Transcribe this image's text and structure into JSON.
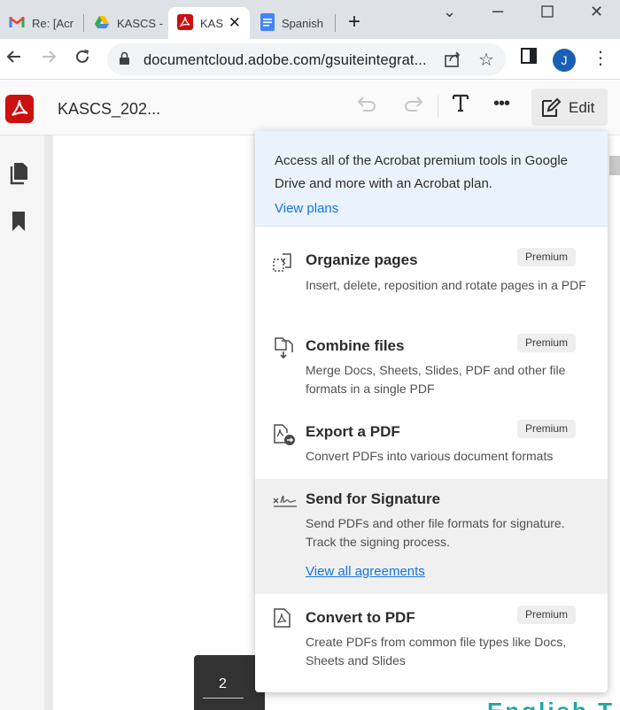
{
  "browser": {
    "tabs": [
      {
        "label": "Re: [Acr",
        "icon": "gmail-icon"
      },
      {
        "label": "KASCS -",
        "icon": "google-drive-icon"
      },
      {
        "label": "KAS",
        "icon": "adobe-acrobat-icon",
        "active": true
      },
      {
        "label": "Spanish",
        "icon": "google-docs-icon"
      }
    ],
    "new_tab_glyph": "+",
    "url": "documentcloud.adobe.com/gsuiteintegrat...",
    "profile_initial": "J",
    "colors": {
      "tabstrip": "#dee1e6",
      "profile": "#1a5fb4"
    }
  },
  "app": {
    "doc_title": "KASCS_202...",
    "edit_label": "Edit",
    "brand_color": "#cc0f0f"
  },
  "viewer": {
    "page_number": "2",
    "doc_peek_text": "English T"
  },
  "popover": {
    "promo_text": "Access all of the Acrobat premium tools in Google Drive and more with an Acrobat plan.",
    "promo_link": "View plans",
    "items": [
      {
        "title": "Organize pages",
        "desc": "Insert, delete, reposition and rotate pages in a PDF",
        "badge": "Premium",
        "icon": "organize-pages-icon"
      },
      {
        "title": "Combine files",
        "desc": "Merge Docs, Sheets, Slides, PDF and other file formats in a single PDF",
        "badge": "Premium",
        "icon": "combine-files-icon"
      },
      {
        "title": "Export a PDF",
        "desc": "Convert PDFs into various document formats",
        "badge": "Premium",
        "icon": "export-pdf-icon"
      },
      {
        "title": "Send for Signature",
        "desc": "Send PDFs and other file formats for signature. Track the signing process.",
        "link": "View all agreements",
        "icon": "signature-icon"
      },
      {
        "title": "Convert to PDF",
        "desc": "Create PDFs from common file types like Docs, Sheets and Slides",
        "badge": "Premium",
        "icon": "convert-pdf-icon"
      }
    ],
    "colors": {
      "promo_bg": "#eaf3fd",
      "link": "#1473e6",
      "hover_bg": "#f0f0f0"
    }
  }
}
